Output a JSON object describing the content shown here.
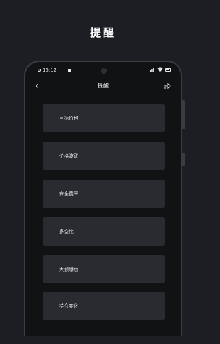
{
  "promo": {
    "title": "提醒"
  },
  "status_bar": {
    "time": "15:12"
  },
  "nav": {
    "back_icon": "‹",
    "title": "提醒"
  },
  "items": [
    {
      "label": "目标价格"
    },
    {
      "label": "价格波动"
    },
    {
      "label": "安全费率"
    },
    {
      "label": "多空比"
    },
    {
      "label": "大额爆仓"
    },
    {
      "label": "持仓变化"
    }
  ],
  "colors": {
    "background": "#1d1e24",
    "screen": "#111214",
    "card": "#2a2b31",
    "text": "#ffffff"
  },
  "icons": [
    "back-icon",
    "share-icon",
    "wifi-icon",
    "signal-icon",
    "battery-icon"
  ]
}
